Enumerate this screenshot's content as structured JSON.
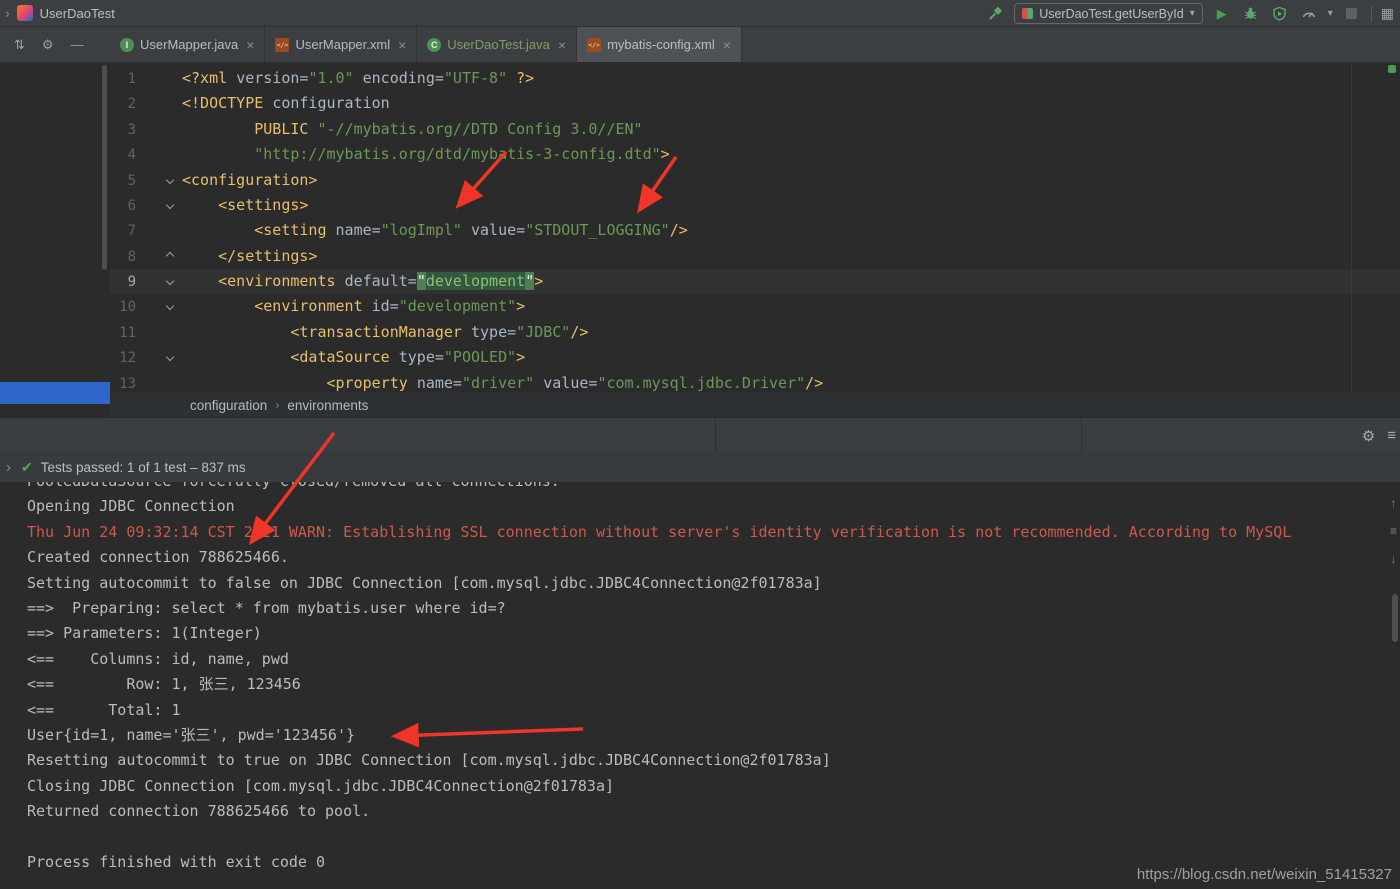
{
  "titlebar": {
    "project": "UserDaoTest",
    "run_config": "UserDaoTest.getUserById"
  },
  "icons": {
    "chevron": "›",
    "sort": "⇅",
    "gear": "⚙",
    "minus": "—",
    "play": "▶",
    "dropdown": "▾",
    "grid": "▦",
    "menu": "≡",
    "close": "×",
    "check": "✔",
    "arrow_up": "↑",
    "arrow_down": "↓",
    "breadcrumb_sep": "›"
  },
  "tabs": [
    {
      "label": "UserMapper.java",
      "icon": "java-interface",
      "letter": "I",
      "active": false,
      "green": false
    },
    {
      "label": "UserMapper.xml",
      "icon": "xml",
      "letter": "</>",
      "active": false,
      "green": false
    },
    {
      "label": "UserDaoTest.java",
      "icon": "java-class",
      "letter": "C",
      "active": false,
      "green": true
    },
    {
      "label": "mybatis-config.xml",
      "icon": "xml",
      "letter": "</>",
      "active": true,
      "green": false
    }
  ],
  "editor": {
    "lines": [
      {
        "n": 1,
        "segments": [
          [
            "tag",
            "<?xml "
          ],
          [
            "attr",
            "version="
          ],
          [
            "str",
            "\"1.0\""
          ],
          [
            "attr",
            " encoding="
          ],
          [
            "str",
            "\"UTF-8\""
          ],
          [
            "tag",
            " ?>"
          ]
        ]
      },
      {
        "n": 2,
        "segments": [
          [
            "tag",
            "<!DOCTYPE "
          ],
          [
            "plain",
            "configuration"
          ]
        ]
      },
      {
        "n": 3,
        "segments": [
          [
            "plain",
            "        "
          ],
          [
            "tag",
            "PUBLIC "
          ],
          [
            "str",
            "\"-//mybatis.org//DTD Config 3.0//EN\""
          ]
        ]
      },
      {
        "n": 4,
        "segments": [
          [
            "plain",
            "        "
          ],
          [
            "str",
            "\"http://mybatis.org/dtd/mybatis-3-config.dtd\""
          ],
          [
            "tag",
            ">"
          ]
        ]
      },
      {
        "n": 5,
        "fold": "down",
        "segments": [
          [
            "tag",
            "<configuration>"
          ]
        ]
      },
      {
        "n": 6,
        "fold": "down",
        "segments": [
          [
            "plain",
            "    "
          ],
          [
            "tag",
            "<settings>"
          ]
        ]
      },
      {
        "n": 7,
        "segments": [
          [
            "plain",
            "        "
          ],
          [
            "tag",
            "<setting "
          ],
          [
            "attr",
            "name="
          ],
          [
            "str",
            "\"logImpl\""
          ],
          [
            "attr",
            " value="
          ],
          [
            "str",
            "\"STDOUT_LOGGING\""
          ],
          [
            "tag",
            "/>"
          ]
        ]
      },
      {
        "n": 8,
        "fold": "up",
        "segments": [
          [
            "plain",
            "    "
          ],
          [
            "tag",
            "</settings>"
          ]
        ]
      },
      {
        "n": 9,
        "current": true,
        "fold": "down",
        "segments": [
          [
            "plain",
            "    "
          ],
          [
            "tag",
            "<environments "
          ],
          [
            "attr",
            "default="
          ],
          [
            "qhl",
            "\""
          ],
          [
            "strhl",
            "development"
          ],
          [
            "qhl",
            "\""
          ],
          [
            "tag",
            ">"
          ]
        ]
      },
      {
        "n": 10,
        "fold": "down",
        "segments": [
          [
            "plain",
            "        "
          ],
          [
            "tag",
            "<environment "
          ],
          [
            "attr",
            "id="
          ],
          [
            "str",
            "\"development\""
          ],
          [
            "tag",
            ">"
          ]
        ]
      },
      {
        "n": 11,
        "segments": [
          [
            "plain",
            "            "
          ],
          [
            "tag",
            "<transactionManager "
          ],
          [
            "attr",
            "type="
          ],
          [
            "str",
            "\"JDBC\""
          ],
          [
            "tag",
            "/>"
          ]
        ]
      },
      {
        "n": 12,
        "fold": "down",
        "segments": [
          [
            "plain",
            "            "
          ],
          [
            "tag",
            "<dataSource "
          ],
          [
            "attr",
            "type="
          ],
          [
            "str",
            "\"POOLED\""
          ],
          [
            "tag",
            ">"
          ]
        ]
      },
      {
        "n": 13,
        "segments": [
          [
            "plain",
            "                "
          ],
          [
            "tag",
            "<property "
          ],
          [
            "attr",
            "name="
          ],
          [
            "str",
            "\"driver\""
          ],
          [
            "attr",
            " value="
          ],
          [
            "str",
            "\"com.mysql.jdbc.Driver\""
          ],
          [
            "tag",
            "/>"
          ]
        ]
      }
    ]
  },
  "breadcrumbs": [
    "configuration",
    "environments"
  ],
  "test_panel": {
    "status": "Tests passed: 1 of 1 test – 837 ms"
  },
  "console": {
    "lines": [
      {
        "k": "out",
        "t": "PooledDataSource forcefully closed/removed all connections."
      },
      {
        "k": "out",
        "t": "Opening JDBC Connection"
      },
      {
        "k": "err",
        "t": "Thu Jun 24 09:32:14 CST 2021 WARN: Establishing SSL connection without server's identity verification is not recommended. According to MySQL"
      },
      {
        "k": "out",
        "t": "Created connection 788625466."
      },
      {
        "k": "out",
        "t": "Setting autocommit to false on JDBC Connection [com.mysql.jdbc.JDBC4Connection@2f01783a]"
      },
      {
        "k": "out",
        "t": "==>  Preparing: select * from mybatis.user where id=?"
      },
      {
        "k": "out",
        "t": "==> Parameters: 1(Integer)"
      },
      {
        "k": "out",
        "t": "<==    Columns: id, name, pwd"
      },
      {
        "k": "out",
        "t": "<==        Row: 1, 张三, 123456"
      },
      {
        "k": "out",
        "t": "<==      Total: 1"
      },
      {
        "k": "out",
        "t": "User{id=1, name='张三', pwd='123456'}"
      },
      {
        "k": "out",
        "t": "Resetting autocommit to true on JDBC Connection [com.mysql.jdbc.JDBC4Connection@2f01783a]"
      },
      {
        "k": "out",
        "t": "Closing JDBC Connection [com.mysql.jdbc.JDBC4Connection@2f01783a]"
      },
      {
        "k": "out",
        "t": "Returned connection 788625466 to pool."
      },
      {
        "k": "out",
        "t": ""
      },
      {
        "k": "out",
        "t": "Process finished with exit code 0"
      }
    ]
  },
  "watermark": "https://blog.csdn.net/weixin_51415327"
}
